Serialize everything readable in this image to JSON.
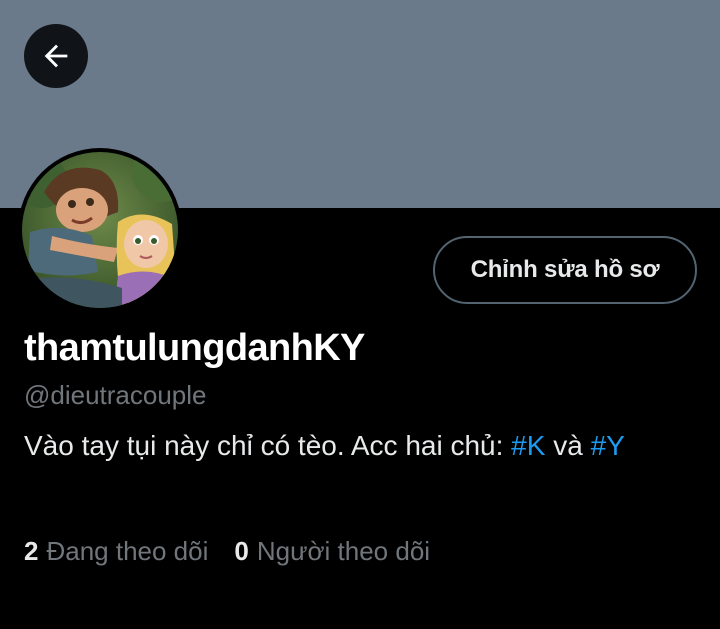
{
  "header": {
    "back_icon": "arrow-left-icon",
    "banner_color": "#6b7a8b"
  },
  "profile": {
    "avatar": "avatar-image",
    "edit_button_label": "Chỉnh sửa hồ sơ",
    "display_name": "thamtulungdanhKY",
    "handle": "@dieutracouple",
    "bio": {
      "text": "Vào tay tụi này chỉ có tèo. Acc hai chủ: ",
      "hashtag_1": "#K",
      "connector": " và ",
      "hashtag_2": "#Y"
    },
    "stats": {
      "following_count": "2",
      "following_label": "Đang theo dõi",
      "followers_count": "0",
      "followers_label": "Người theo dõi"
    }
  },
  "colors": {
    "background": "#000000",
    "text_primary": "#e7e9ea",
    "text_secondary": "#71767b",
    "link": "#1d9bf0",
    "button_border": "#536471"
  }
}
